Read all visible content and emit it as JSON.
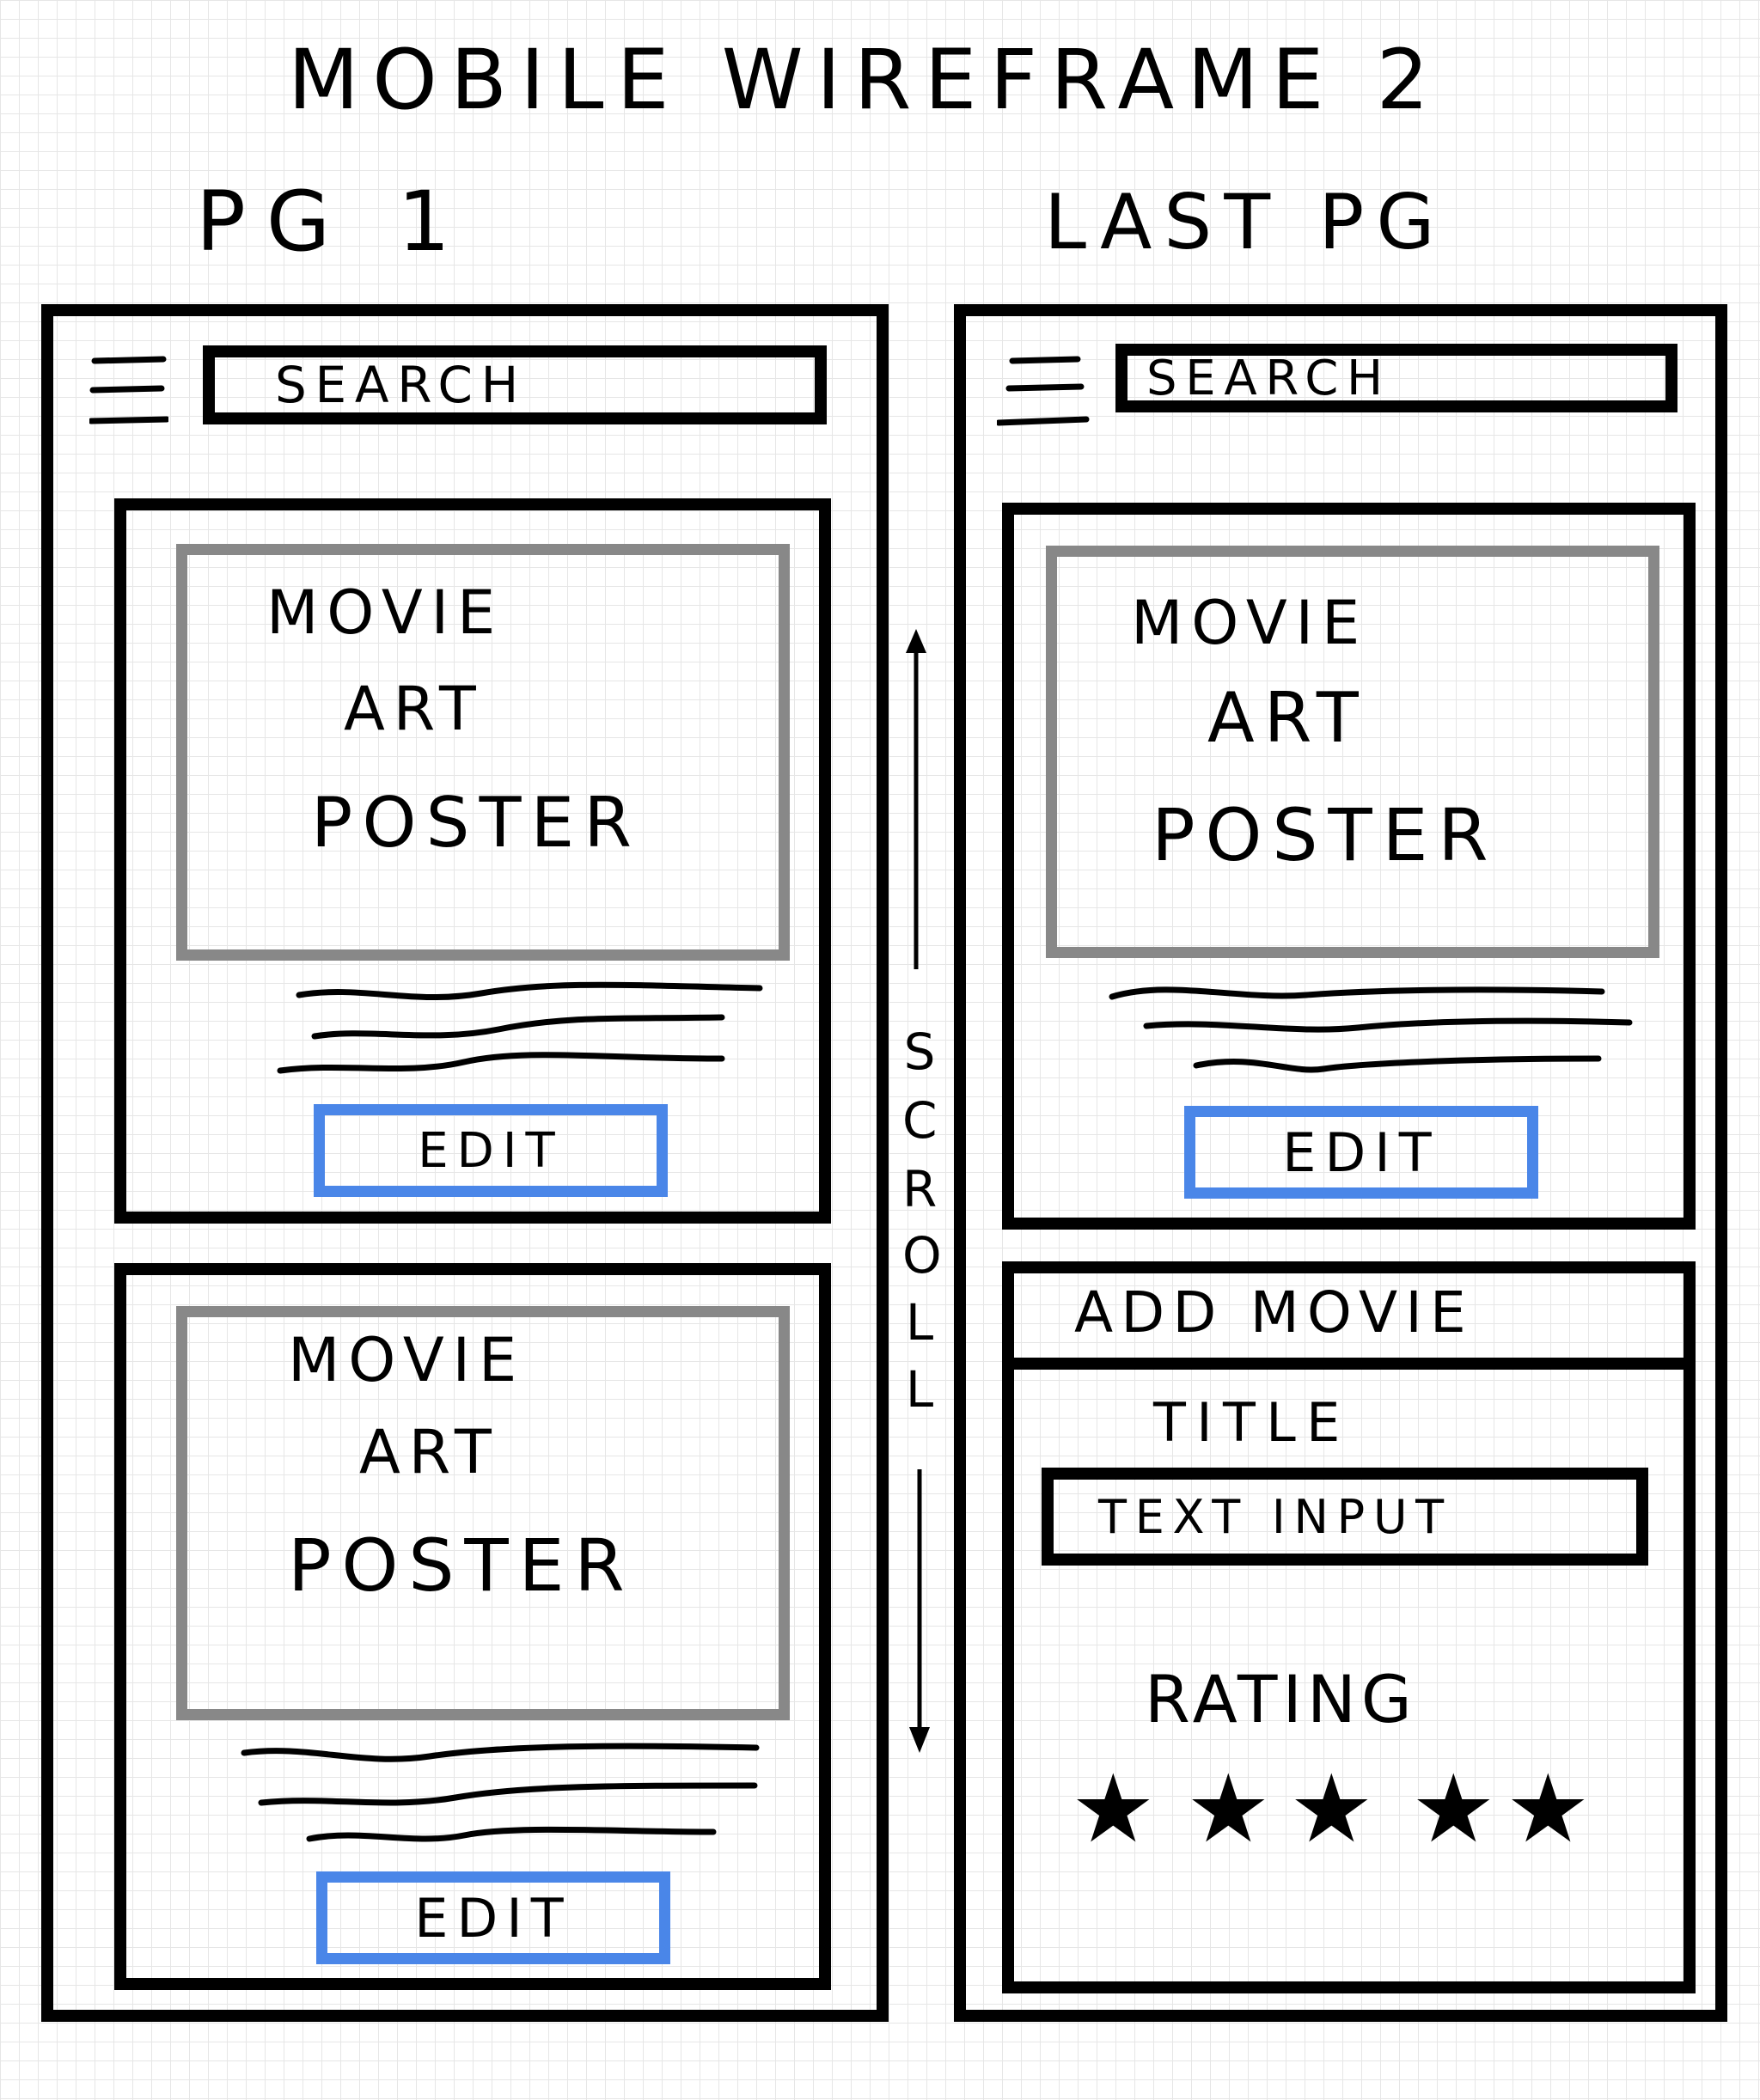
{
  "title": "MOBILE WIREFRAME 2",
  "pages": {
    "first": {
      "label": "PG 1",
      "search_label": "SEARCH",
      "cards": [
        {
          "poster": [
            "MOVIE",
            "ART",
            "POSTER"
          ],
          "button": "EDIT"
        },
        {
          "poster": [
            "MOVIE",
            "ART",
            "POSTER"
          ],
          "button": "EDIT"
        }
      ]
    },
    "last": {
      "label": "LAST PG",
      "search_label": "SEARCH",
      "card": {
        "poster": [
          "MOVIE",
          "ART",
          "POSTER"
        ],
        "button": "EDIT"
      },
      "add_movie": {
        "header": "ADD MOVIE",
        "title_label": "TITLE",
        "text_input": "TEXT INPUT",
        "rating_label": "RATING",
        "stars": [
          "★",
          "★",
          "★",
          "★",
          "★"
        ]
      }
    }
  },
  "scroll_letters": [
    "S",
    "C",
    "R",
    "O",
    "L",
    "L"
  ],
  "colors": {
    "frame": "#000000",
    "poster_border": "#888888",
    "button_border": "#4a86e8",
    "grid": "#e6e6e6"
  },
  "icons": {
    "menu": "hamburger-icon",
    "scroll": "double-arrow-icon",
    "rating": "star-icon"
  }
}
